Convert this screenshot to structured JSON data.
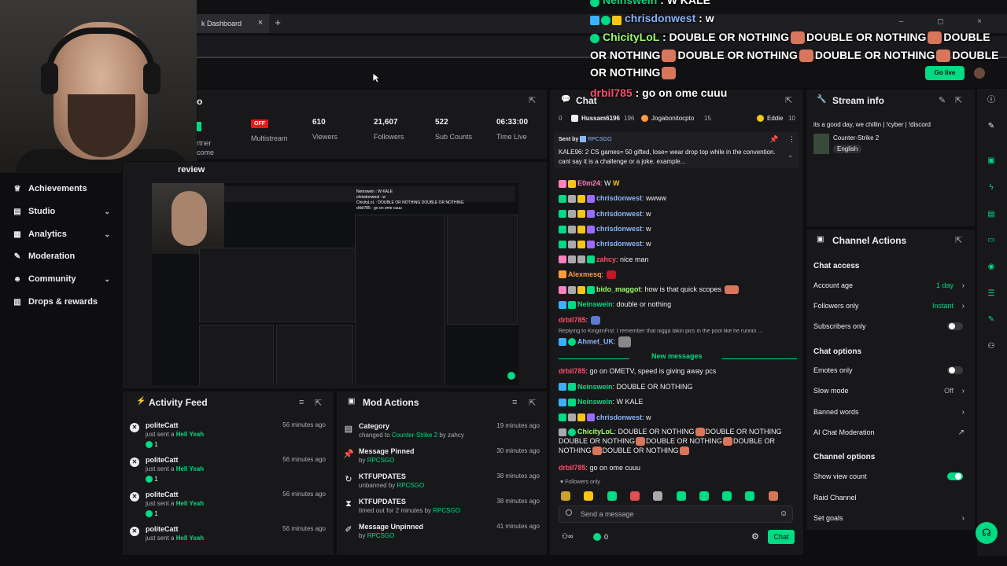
{
  "browser": {
    "tab_title": "k Dashboard",
    "tab_close": "×",
    "new_tab": "+",
    "window_controls": "– ◻ ×"
  },
  "overlay_chat": [
    {
      "user": "Neinswein",
      "text": ": W KALE",
      "color": "#00db84"
    },
    {
      "user": "chrisdonwest",
      "text": ": w",
      "color": "#8ab4f8"
    },
    {
      "user": "ChicityLoL",
      "text": ": DOUBLE OR NOTHING",
      "color": "#9dfc66",
      "rest": [
        "DOUBLE OR NOTHING",
        "DOUBLE",
        "OR NOTHING",
        "DOUBLE OR NOTHING",
        "DOUBLE OR NOTHING",
        "DOUBLE",
        "OR NOTHING"
      ]
    },
    {
      "user": "drbil785",
      "text": ": go on ome cuuu",
      "color": "#ff4d6a"
    }
  ],
  "go_live": "Go live",
  "sidebar": {
    "items": [
      {
        "label": "Achievements",
        "icon": "trophy-icon"
      },
      {
        "label": "Studio",
        "icon": "studio-icon"
      },
      {
        "label": "Analytics",
        "icon": "analytics-icon"
      },
      {
        "label": "Moderation",
        "icon": "wrench-icon"
      },
      {
        "label": "Community",
        "icon": "community-icon"
      },
      {
        "label": "Drops & rewards",
        "icon": "drops-icon"
      }
    ]
  },
  "quick_stats": {
    "partner_line1": "rtner",
    "partner_line2": "come",
    "multistream_badge": "OFF",
    "multistream_label": "Multistream",
    "viewers": "610",
    "viewers_label": "Viewers",
    "followers": "21,607",
    "followers_label": "Followers",
    "subs": "522",
    "subs_label": "Sub Counts",
    "time": "06:33:00",
    "time_label": "Time Live"
  },
  "preview_title": "review",
  "activity_feed": {
    "title": "Activity Feed",
    "items": [
      {
        "name": "politeCatt",
        "sub": "just sent a",
        "gift": "Hell Yeah",
        "count": "1",
        "time": "56 minutes ago"
      },
      {
        "name": "politeCatt",
        "sub": "just sent a",
        "gift": "Hell Yeah",
        "count": "1",
        "time": "56 minutes ago"
      },
      {
        "name": "politeCatt",
        "sub": "just sent a",
        "gift": "Hell Yeah",
        "count": "1",
        "time": "56 minutes ago"
      },
      {
        "name": "politeCatt",
        "sub": "just sent a",
        "gift": "Hell Yeah",
        "count": "",
        "time": "56 minutes ago"
      }
    ]
  },
  "mod_actions": {
    "title": "Mod Actions",
    "items": [
      {
        "title": "Category",
        "pre": "changed to",
        "hl": "Counter-Strike 2",
        "post": "by zahcy",
        "time": "19 minutes ago",
        "icon": "category-icon"
      },
      {
        "title": "Message Pinned",
        "pre": "by",
        "hl": "RPCSGO",
        "post": "",
        "time": "30 minutes ago",
        "icon": "pin-icon"
      },
      {
        "title": "KTFUPDATES",
        "pre": "unbanned by",
        "hl": "RPCSGO",
        "post": "",
        "time": "38 minutes ago",
        "icon": "unban-icon"
      },
      {
        "title": "KTFUPDATES",
        "pre": "timed out for 2 minutes by",
        "hl": "RPCSGO",
        "post": "",
        "time": "38 minutes ago",
        "icon": "timeout-icon"
      },
      {
        "title": "Message Unpinned",
        "pre": "by",
        "hl": "RPCSGO",
        "post": "",
        "time": "41 minutes ago",
        "icon": "unpin-icon"
      }
    ]
  },
  "chat": {
    "title": "Chat",
    "leaderboard": [
      {
        "rank": "0",
        "name": "Hussam6196",
        "n": "196"
      },
      {
        "name": "Jogabonitocpto",
        "n": "15"
      },
      {
        "name": "Eddie",
        "n": "10"
      }
    ],
    "pinned": {
      "sent_by": "Sent by",
      "by_user": "RPCSGO",
      "text": "KALE96: 2 CS games= 50 gifted, lose= wear drop top while in the convention. cant say it is a challenge or a joke. example..."
    },
    "messages": [
      {
        "user": "E0m24",
        "text": ": W",
        "color": "#ff7fbf"
      },
      {
        "user": "chrisdonwest",
        "text": ": wwww",
        "color": "#8ab4f8"
      },
      {
        "user": "chrisdonwest",
        "text": ": w",
        "color": "#8ab4f8"
      },
      {
        "user": "chrisdonwest",
        "text": ": w",
        "color": "#8ab4f8"
      },
      {
        "user": "chrisdonwest",
        "text": ": w",
        "color": "#8ab4f8"
      },
      {
        "user": "zahcy",
        "text": ": nice man",
        "color": "#ff4d6a"
      },
      {
        "user": "Alexmesq",
        "text": ":",
        "color": "#ff9b3d"
      },
      {
        "user": "bido_maggot",
        "text": ": how is that quick scopes",
        "color": "#9dfc66"
      },
      {
        "user": "Neinswein",
        "text": ": double or nothing",
        "color": "#00db84"
      },
      {
        "user": "drbil785",
        "text": ":",
        "color": "#ff4d6a"
      }
    ],
    "reply_line": "Replying to KingirnFist: I remember that nigga takin pics in the pool like he runnin ...",
    "reply_msg": {
      "user": "Ahmet_UK",
      "text": ":",
      "color": "#8ab4f8"
    },
    "new_messages": "New messages",
    "messages2": [
      {
        "user": "drbil785",
        "text": ": go on OMETV, speed is giving away pcs",
        "color": "#ff4d6a"
      },
      {
        "user": "Neinswein",
        "text": ": DOUBLE OR NOTHING",
        "color": "#00db84"
      },
      {
        "user": "Neinswein",
        "text": ": W KALE",
        "color": "#00db84"
      },
      {
        "user": "chrisdonwest",
        "text": ": w",
        "color": "#8ab4f8"
      }
    ],
    "chicity": {
      "user": "ChicityLoL",
      "line1": ": DOUBLE OR NOTHING",
      "line1b": "DOUBLE OR NOTHING",
      "line2a": "DOUBLE OR NOTHING",
      "line2b": "DOUBLE OR NOTHING",
      "line2c": "DOUBLE OR",
      "line3a": "NOTHING",
      "line3b": "DOUBLE OR NOTHING",
      "color": "#9dfc66"
    },
    "last": {
      "user": "drbil785",
      "text": ": go on ome cuuu",
      "color": "#ff4d6a"
    },
    "followers_only": "Followers only",
    "placeholder": "Send a message",
    "points": "0",
    "send": "Chat"
  },
  "stream_info": {
    "title": "Stream info",
    "stream_title": "its a good day, we chillin | !cyber | !discord",
    "category": "Counter-Strike 2",
    "language": "English"
  },
  "channel_actions": {
    "title": "Channel Actions",
    "chat_access": "Chat access",
    "account_age": "Account age",
    "account_age_val": "1 day",
    "followers_only": "Followers only",
    "followers_only_val": "Instant",
    "subscribers_only": "Subscribers only",
    "chat_options": "Chat options",
    "emotes_only": "Emotes only",
    "slow_mode": "Slow mode",
    "slow_mode_val": "Off",
    "banned_words": "Banned words",
    "ai_mod": "AI Chat Moderation",
    "channel_options": "Channel options",
    "show_view_count": "Show view count",
    "raid_channel": "Raid Channel",
    "set_goals": "Set goals"
  },
  "colors": {
    "accent": "#00db84",
    "bg": "#0e0e10",
    "panel": "#18181b"
  }
}
